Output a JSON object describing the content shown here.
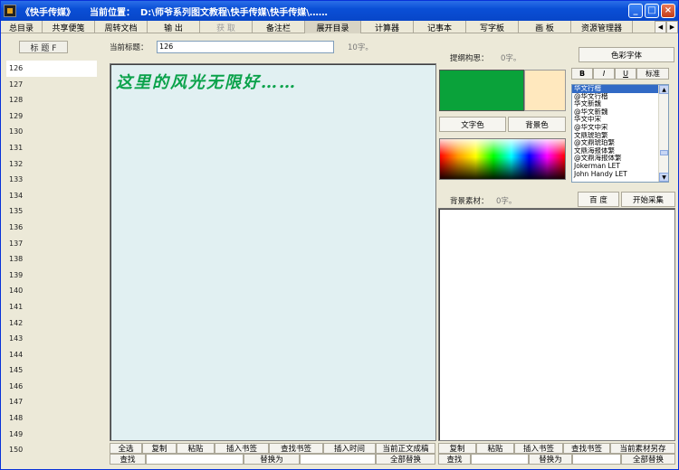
{
  "window": {
    "title": "《快手传媒》",
    "location_label": "当前位置：",
    "location_path": "D:\\师爷系列图文教程\\快手传媒\\快手传媒\\……",
    "minimize": "_",
    "maximize": "□",
    "close": "×"
  },
  "menu": [
    {
      "label": "总目录",
      "w": 46
    },
    {
      "label": "共享便笺",
      "w": 58
    },
    {
      "label": "周转文档",
      "w": 58
    },
    {
      "label": "输  出",
      "w": 58
    },
    {
      "label": "获  取",
      "w": 58
    },
    {
      "label": "备注栏",
      "w": 58
    },
    {
      "label": "展开目录",
      "w": 62
    },
    {
      "label": "计算器",
      "w": 58
    },
    {
      "label": "记事本",
      "w": 58
    },
    {
      "label": "写字板",
      "w": 58
    },
    {
      "label": "画  板",
      "w": 58
    },
    {
      "label": "资源管理器",
      "w": 68
    }
  ],
  "menu_arrows": {
    "left": "◀",
    "right": "▶"
  },
  "gutter": {
    "header": "标 题 F",
    "lines": [
      "126",
      "127",
      "128",
      "129",
      "130",
      "131",
      "132",
      "133",
      "134",
      "135",
      "136",
      "137",
      "138",
      "139",
      "140",
      "141",
      "142",
      "143",
      "144",
      "145",
      "146",
      "147",
      "148",
      "149",
      "150"
    ]
  },
  "editor": {
    "title_label": "当前标题：",
    "title_value": "126",
    "char_count": "10字。",
    "content": "这里的风光无限好……"
  },
  "editor_buttons": {
    "select_all": "全选",
    "copy": "复制",
    "paste": "粘贴",
    "insert_bookmark": "插入书签",
    "find_bookmark": "查找书签",
    "insert_time": "插入时间",
    "current_to_draft": "当前正文成稿",
    "find": "查找",
    "replace_with": "替换为",
    "replace_all": "全部替换"
  },
  "outline": {
    "label": "提纲构思：",
    "count": "0字。",
    "color_font_button": "色彩字体"
  },
  "colors": {
    "text_color": "#0aa23a",
    "bg_color": "#ffe8be",
    "text_color_button": "文字色",
    "bg_color_button": "背景色"
  },
  "style_buttons": {
    "bold": "B",
    "italic": "I",
    "underline": "U",
    "standard": "标准"
  },
  "font_list": {
    "selected": 0,
    "items": [
      "华文行楷",
      "@华文行楷",
      "华文新魏",
      "@华文新魏",
      "华文中宋",
      "@华文中宋",
      "文鼎琥珀繁",
      "@文鼎琥珀繁",
      "文鼎海报体繁",
      "@文鼎海报体繁",
      "Jokerman LET",
      "John Handy LET"
    ]
  },
  "material": {
    "label": "背景素材：",
    "count": "0字。",
    "baidu_button": "百 度",
    "collect_button": "开始采集"
  },
  "material_buttons": {
    "copy": "复制",
    "paste": "粘贴",
    "insert_bookmark": "插入书签",
    "find_bookmark": "查找书签",
    "save_material": "当前素材另存",
    "find": "查找",
    "replace_with": "替换为",
    "replace_all": "全部替换"
  }
}
